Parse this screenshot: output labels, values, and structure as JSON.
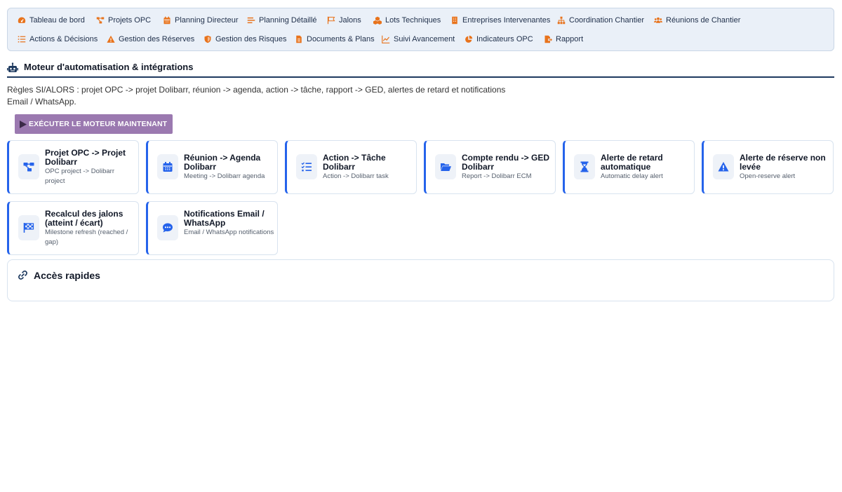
{
  "nav": {
    "row1": [
      {
        "label": "Tableau de bord",
        "icon": "dashboard-icon"
      },
      {
        "label": "Projets OPC",
        "icon": "project-diagram-icon"
      },
      {
        "label": "Planning Directeur",
        "icon": "calendar-icon"
      },
      {
        "label": "Planning Détaillé",
        "icon": "bars-icon"
      },
      {
        "label": "Jalons",
        "icon": "flag-icon"
      },
      {
        "label": "Lots Techniques",
        "icon": "cubes-icon"
      },
      {
        "label": "Entreprises Intervenantes",
        "icon": "building-icon"
      },
      {
        "label": "Coordination Chantier",
        "icon": "sitemap-icon"
      },
      {
        "label": "Réunions de Chantier",
        "icon": "users-icon"
      }
    ],
    "row2": [
      {
        "label": "Actions & Décisions",
        "icon": "list-icon"
      },
      {
        "label": "Gestion des Réserves",
        "icon": "warning-icon"
      },
      {
        "label": "Gestion des Risques",
        "icon": "shield-icon"
      },
      {
        "label": "Documents & Plans",
        "icon": "file-icon"
      },
      {
        "label": "Suivi Avancement",
        "icon": "chart-line-icon"
      },
      {
        "label": "Indicateurs OPC",
        "icon": "pie-chart-icon"
      },
      {
        "label": "Rapport",
        "icon": "file-export-icon"
      }
    ],
    "icon_color": "#e8731c"
  },
  "section": {
    "title": "Moteur d'automatisation & intégrations",
    "icon": "robot-icon",
    "description": "Règles SI/ALORS : projet OPC -> projet Dolibarr, réunion -> agenda, action -> tâche, rapport -> GED, alertes de retard et notifications Email / WhatsApp.",
    "run_button": "EXÉCUTER LE MOTEUR MAINTENANT"
  },
  "cards": [
    {
      "title": "Projet OPC -> Projet Dolibarr",
      "subtitle": "OPC project -> Dolibarr project",
      "icon": "project-diagram-icon"
    },
    {
      "title": "Réunion -> Agenda Dolibarr",
      "subtitle": "Meeting -> Dolibarr agenda",
      "icon": "calendar-icon"
    },
    {
      "title": "Action -> Tâche Dolibarr",
      "subtitle": "Action -> Dolibarr task",
      "icon": "tasks-icon"
    },
    {
      "title": "Compte rendu -> GED Dolibarr",
      "subtitle": "Report -> Dolibarr ECM",
      "icon": "folder-open-icon"
    },
    {
      "title": "Alerte de retard automatique",
      "subtitle": "Automatic delay alert",
      "icon": "hourglass-icon"
    },
    {
      "title": "Alerte de réserve non levée",
      "subtitle": "Open-reserve alert",
      "icon": "warning-icon"
    },
    {
      "title": "Recalcul des jalons (atteint / écart)",
      "subtitle": "Milestone refresh (reached / gap)",
      "icon": "checkered-flag-icon"
    },
    {
      "title": "Notifications Email / WhatsApp",
      "subtitle": "Email / WhatsApp notifications",
      "icon": "chat-icon"
    }
  ],
  "quick_access": {
    "title": "Accès rapides",
    "icon": "link-icon"
  },
  "colors": {
    "accent": "#2563eb",
    "button": "#9b79b0",
    "nav_bg": "#eaf0f8",
    "heading_rule": "#1e3a5f"
  }
}
